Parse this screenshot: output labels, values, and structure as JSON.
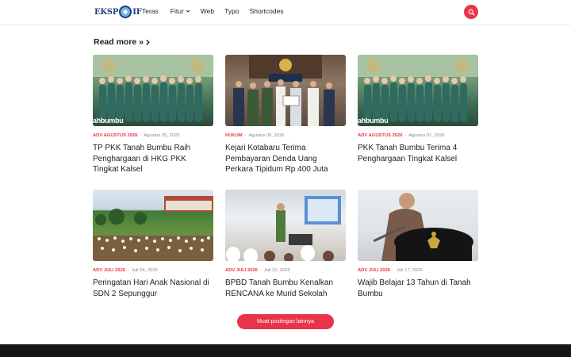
{
  "header": {
    "logo_text_left": "EKSP",
    "logo_text_right": "IF",
    "nav": [
      {
        "label": "Teras"
      },
      {
        "label": "Fitur",
        "has_dropdown": true
      },
      {
        "label": "Web"
      },
      {
        "label": "Typo"
      },
      {
        "label": "Shortcodes"
      }
    ],
    "search_icon": "search-icon"
  },
  "read_more": {
    "label": "Read more »",
    "icon": "chevron-right-icon"
  },
  "posts": [
    {
      "category": "ADV AGUSTUS 2026",
      "date": "Agustus 05, 2026",
      "title": "TP PKK Tanah Bumbu Raih Penghargaan di HKG PKK Tingkat Kalsel",
      "image_caption": "ahbumbu"
    },
    {
      "category": "HUKUM",
      "date": "Agustus 05, 2026",
      "title": "Kejari Kotabaru Terima Pembayaran Denda Uang Perkara Tipidum Rp 400 Juta"
    },
    {
      "category": "ADV AGUSTUS 2026",
      "date": "Agustus 01, 2026",
      "title": "PKK Tanah Bumbu Terima 4 Penghargaan Tingkat Kalsel",
      "image_caption": "ahbumbu"
    },
    {
      "category": "ADV JULI 2026",
      "date": "Juli 24, 2026",
      "title": "Peringatan Hari Anak Nasional di SDN 2 Sepunggur"
    },
    {
      "category": "ADV JULI 2026",
      "date": "Juli 21, 2026",
      "title": "BPBD Tanah Bumbu Kenalkan RENCANA ke Murid Sekolah"
    },
    {
      "category": "ADV JULI 2026",
      "date": "Juli 17, 2026",
      "title": "Wajib Belajar 13 Tahun di Tanah Bumbu"
    }
  ],
  "meta_separator": "-",
  "load_more": {
    "label": "Muat postingan lainnya"
  },
  "colors": {
    "accent": "#e8344a",
    "footer": "#161616",
    "logo": "#1f3f7a"
  }
}
